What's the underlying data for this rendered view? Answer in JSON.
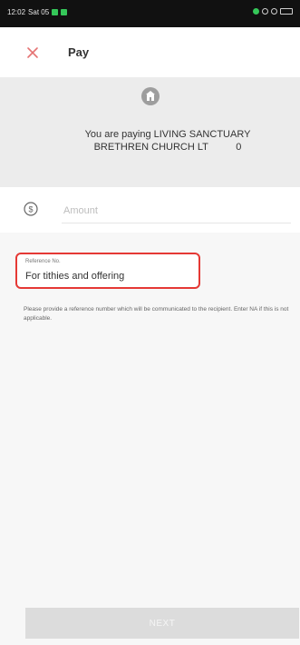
{
  "status_bar": {
    "time": "12:02",
    "day": "Sat 05"
  },
  "header": {
    "title": "Pay"
  },
  "recipient": {
    "line1": "You are paying LIVING SANCTUARY",
    "line2": "BRETHREN CHURCH LT          0"
  },
  "amount": {
    "placeholder": "Amount",
    "value": ""
  },
  "reference": {
    "label": "Reference No.",
    "value": "For tithies and offering",
    "help": "Please provide a reference number which will be communicated to the recipient. Enter NA if this is not applicable."
  },
  "actions": {
    "next_label": "NEXT"
  },
  "colors": {
    "highlight": "#e53935",
    "close": "#e57373"
  },
  "icons": [
    "close-icon",
    "church-icon",
    "currency-icon"
  ]
}
